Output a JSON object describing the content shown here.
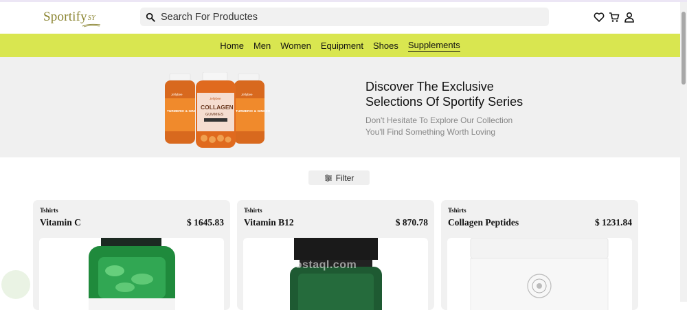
{
  "header": {
    "logo_text": "Sportify",
    "logo_suffix": "SY",
    "search": {
      "placeholder": "Search For Productes",
      "value": ""
    },
    "icons": [
      "heart-icon",
      "cart-icon",
      "user-icon"
    ]
  },
  "nav": {
    "items": [
      "Home",
      "Men",
      "Women",
      "Equipment",
      "Shoes",
      "Supplements"
    ],
    "active": "Supplements"
  },
  "hero": {
    "title_line1": "Discover The Exclusive",
    "title_line2": "Selections Of Sportify Series",
    "sub_line1": "Don't Hesitate To Explore Our Collection",
    "sub_line2": "You'll Find Something Worth Loving",
    "bottle_labels": [
      "Jellybee",
      "TURMERIC & GINGER",
      "COLLAGEN",
      "GUMMIES"
    ]
  },
  "filter": {
    "label": "Filter"
  },
  "products": [
    {
      "category": "Tshirts",
      "name": "Vitamin C",
      "price": "$ 1645.83"
    },
    {
      "category": "Tshirts",
      "name": "Vitamin B12",
      "price": "$ 870.78"
    },
    {
      "category": "Tshirts",
      "name": "Collagen Peptides",
      "price": "$ 1231.84"
    }
  ],
  "watermark": "mostaql.com",
  "colors": {
    "accent": "#d9e650",
    "logo": "#8a8430",
    "hero_bg": "#f0f0f0"
  }
}
